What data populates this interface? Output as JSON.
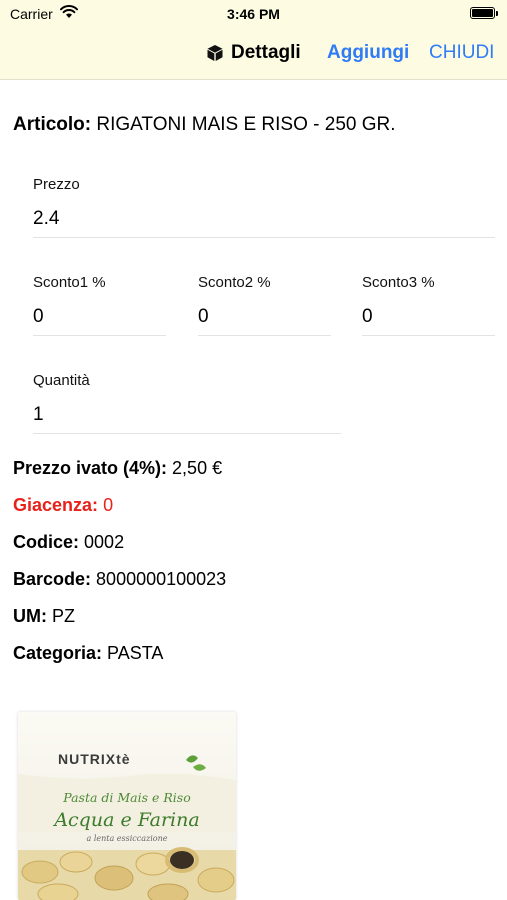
{
  "status": {
    "carrier": "Carrier",
    "time": "3:46 PM",
    "wifi_icon": "wifi-icon",
    "battery_icon": "battery-icon"
  },
  "nav": {
    "title": "Dettagli",
    "title_icon": "cube-icon",
    "add_label": "Aggiungi",
    "close_label": "CHIUDI",
    "accent_color": "#2f7cf6"
  },
  "article": {
    "label": "Articolo:",
    "value": "RIGATONI MAIS E RISO - 250 GR."
  },
  "fields": {
    "prezzo": {
      "label": "Prezzo",
      "value": "2.4"
    },
    "sconto1": {
      "label": "Sconto1 %",
      "value": "0"
    },
    "sconto2": {
      "label": "Sconto2 %",
      "value": "0"
    },
    "sconto3": {
      "label": "Sconto3 %",
      "value": "0"
    },
    "quantita": {
      "label": "Quantità",
      "value": "1"
    }
  },
  "info": {
    "prezzo_ivato": {
      "label": "Prezzo ivato (4%):",
      "value": "2,50 €"
    },
    "giacenza": {
      "label": "Giacenza:",
      "value": "0",
      "color": "#e8221b"
    },
    "codice": {
      "label": "Codice:",
      "value": "0002"
    },
    "barcode": {
      "label": "Barcode:",
      "value": "8000000100023"
    },
    "um": {
      "label": "UM:",
      "value": "PZ"
    },
    "categoria": {
      "label": "Categoria:",
      "value": "PASTA"
    }
  },
  "product_image": {
    "brand": "NUTRIXtè",
    "line1": "Pasta di Mais e Riso",
    "line2": "Acqua e Farina",
    "line3": "a lenta essiccazione"
  }
}
